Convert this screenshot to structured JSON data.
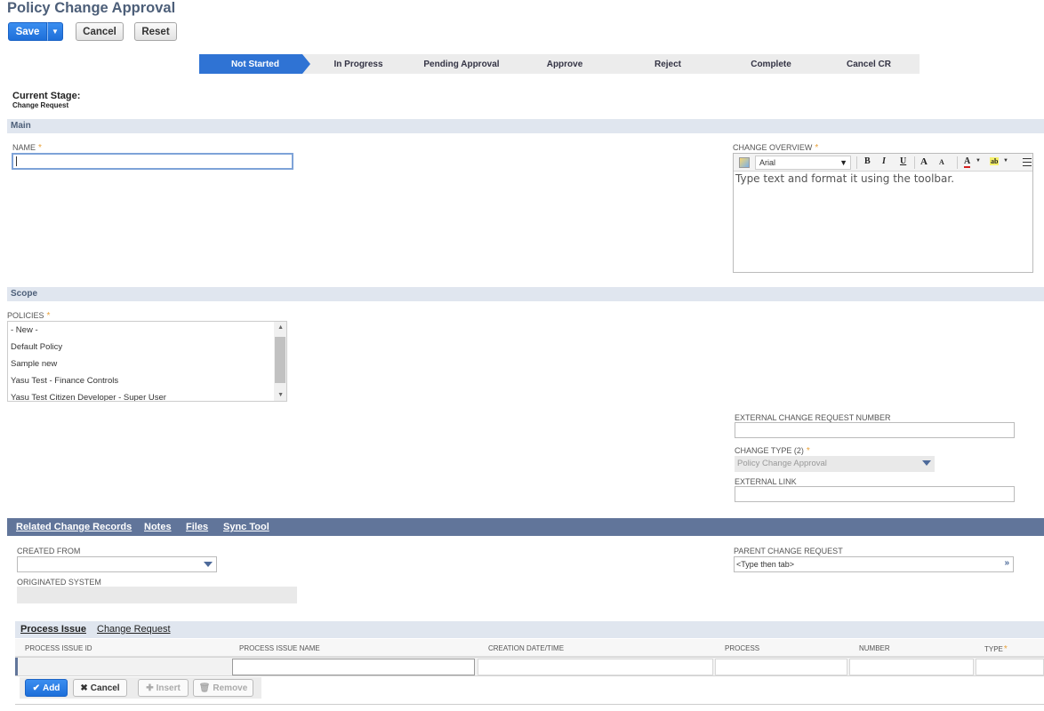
{
  "page": {
    "title": "Policy Change Approval"
  },
  "toolbar": {
    "save_label": "Save",
    "save_menu_icon": "caret-down-icon",
    "cancel_label": "Cancel",
    "reset_label": "Reset"
  },
  "stages": [
    {
      "label": "Not Started",
      "active": true
    },
    {
      "label": "In Progress",
      "active": false
    },
    {
      "label": "Pending Approval",
      "active": false
    },
    {
      "label": "Approve",
      "active": false
    },
    {
      "label": "Reject",
      "active": false
    },
    {
      "label": "Complete",
      "active": false
    },
    {
      "label": "Cancel CR",
      "active": false
    }
  ],
  "current_stage": {
    "label": "Current Stage:",
    "value": "Change Request"
  },
  "main_section": {
    "title": "Main",
    "name_label": "NAME",
    "name_value": "",
    "required_mark": "*",
    "change_overview": {
      "label": "CHANGE OVERVIEW",
      "font": "Arial",
      "toolbar_icons": [
        "format-icon",
        "bold-icon",
        "italic-icon",
        "underline-icon",
        "font-grow-icon",
        "font-shrink-icon",
        "text-color-icon",
        "highlight-icon",
        "align-icon"
      ],
      "bold": "B",
      "italic": "I",
      "underline": "U",
      "grow": "A",
      "shrink": "A",
      "text_color": "A",
      "highlight": "ab",
      "placeholder": "Type text and format it using the toolbar."
    }
  },
  "scope_section": {
    "title": "Scope",
    "policies_label": "POLICIES",
    "policies": [
      "- New -",
      "Default Policy",
      "Sample new",
      "Yasu Test - Finance Controls",
      "Yasu Test Citizen Developer - Super User"
    ],
    "ext_cr_label": "EXTERNAL CHANGE REQUEST NUMBER",
    "ext_cr_value": "",
    "change_type_label": "CHANGE TYPE (2)",
    "change_type_value": "Policy Change Approval",
    "ext_link_label": "EXTERNAL LINK",
    "ext_link_value": ""
  },
  "tabs": [
    {
      "label": "Related Change Records",
      "active": true
    },
    {
      "label": "Notes",
      "active": false
    },
    {
      "label": "Files",
      "active": false
    },
    {
      "label": "Sync Tool",
      "active": false
    }
  ],
  "related": {
    "created_from_label": "CREATED FROM",
    "created_from_value": "",
    "originated_label": "ORIGINATED SYSTEM",
    "originated_value": "",
    "parent_label": "PARENT CHANGE REQUEST",
    "parent_placeholder": "<Type then tab>"
  },
  "subtabs": [
    {
      "label": "Process Issue",
      "active": true
    },
    {
      "label": "Change Request",
      "active": false
    }
  ],
  "grid": {
    "columns": [
      "PROCESS ISSUE ID",
      "PROCESS ISSUE NAME",
      "CREATION DATE/TIME",
      "PROCESS",
      "NUMBER",
      "TYPE"
    ],
    "buttons": {
      "add": "Add",
      "cancel": "Cancel",
      "insert": "Insert",
      "remove": "Remove"
    }
  },
  "colors": {
    "accent": "#2f73d4",
    "section_bg": "#e0e6ef",
    "tabbar_bg": "#61759a",
    "title": "#4d5f79",
    "required": "#e8a13a"
  }
}
